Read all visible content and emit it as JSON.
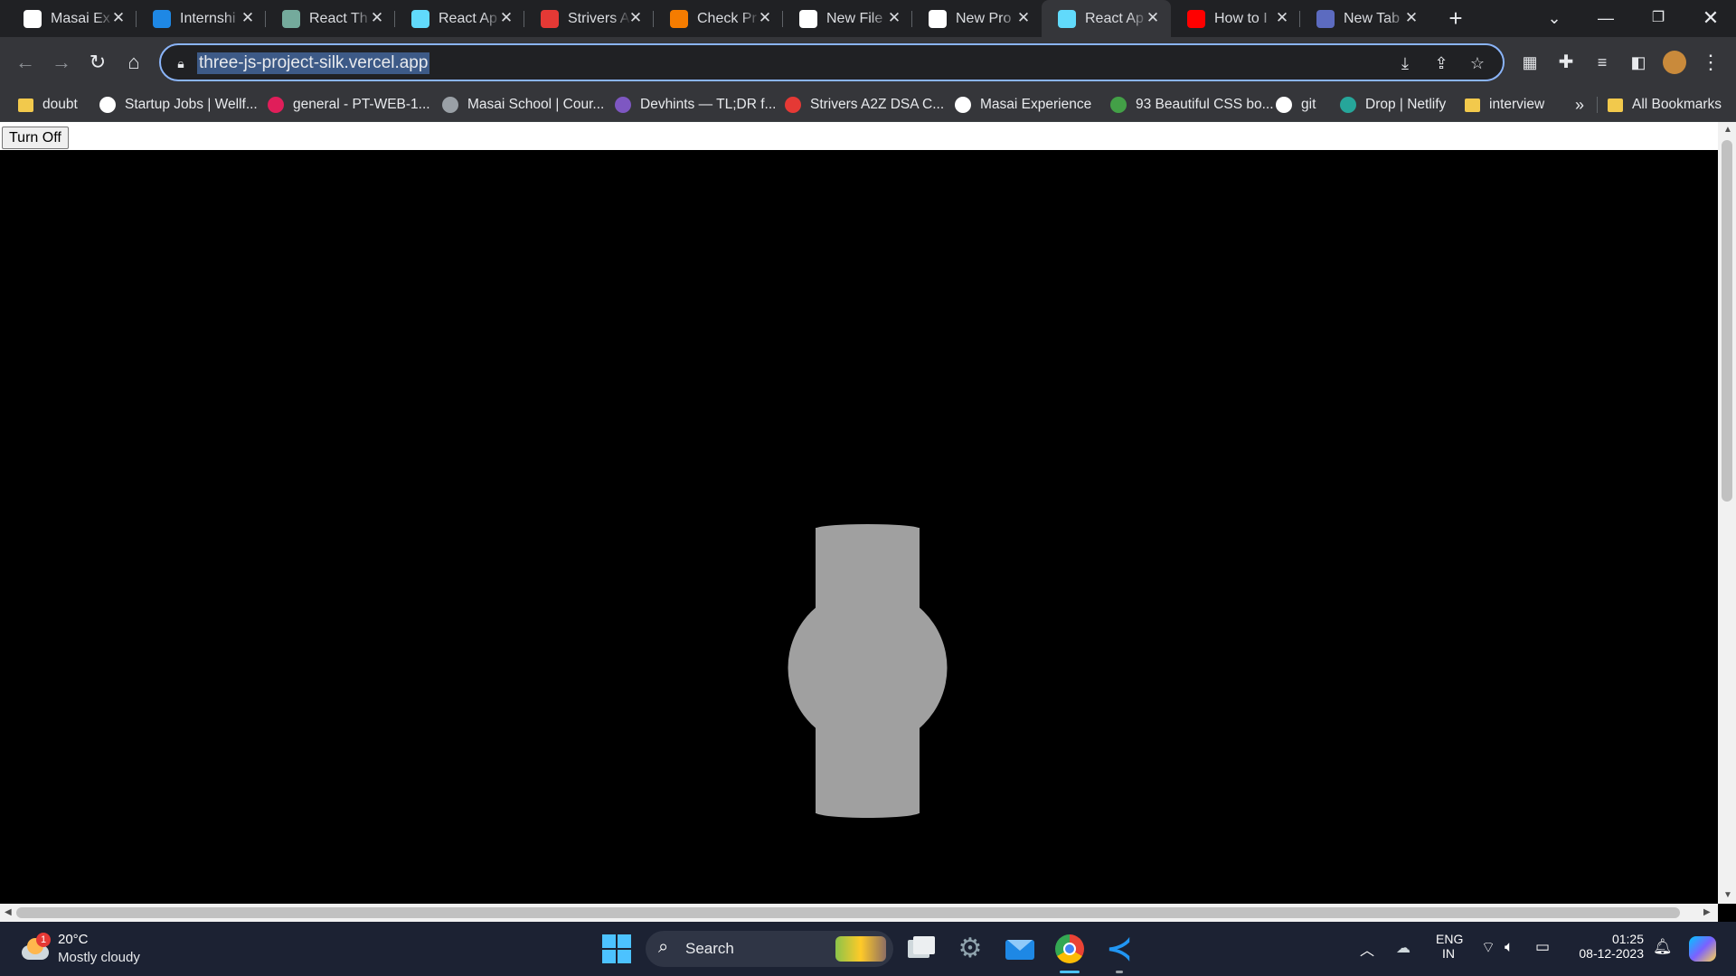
{
  "browser": {
    "tabs": [
      {
        "title": "Masai Ex",
        "icon": "masai-icon",
        "color": "#ffffff"
      },
      {
        "title": "Internshi",
        "icon": "internshala-icon",
        "color": "#1e88e5"
      },
      {
        "title": "React Th",
        "icon": "chatgpt-icon",
        "color": "#74aa9c"
      },
      {
        "title": "React Ap",
        "icon": "react-icon",
        "color": "#61dafb"
      },
      {
        "title": "Strivers A",
        "icon": "tuf-icon",
        "color": "#e53935"
      },
      {
        "title": "Check Pr",
        "icon": "codechef-icon",
        "color": "#f57c00"
      },
      {
        "title": "New File",
        "icon": "github-icon",
        "color": "#ffffff"
      },
      {
        "title": "New Pro",
        "icon": "vercel-icon",
        "color": "#ffffff"
      },
      {
        "title": "React Ap",
        "icon": "react-icon",
        "color": "#61dafb",
        "active": true
      },
      {
        "title": "How to I",
        "icon": "youtube-icon",
        "color": "#ff0000"
      },
      {
        "title": "New Tab",
        "icon": "newtab-icon",
        "color": "#5c6bc0"
      }
    ],
    "new_tab_symbol": "+",
    "url": "three-js-project-silk.vercel.app",
    "bookmarks": [
      {
        "label": "doubt",
        "icon": "folder-icon"
      },
      {
        "label": "Startup Jobs | Wellf...",
        "icon": "wellfound-icon"
      },
      {
        "label": "general - PT-WEB-1...",
        "icon": "slack-icon"
      },
      {
        "label": "Masai School | Cour...",
        "icon": "globe-icon"
      },
      {
        "label": "Devhints — TL;DR f...",
        "icon": "devhints-icon"
      },
      {
        "label": "Strivers A2Z DSA C...",
        "icon": "tuf-icon"
      },
      {
        "label": "Masai Experience",
        "icon": "masai-icon"
      },
      {
        "label": "93 Beautiful CSS bo...",
        "icon": "css-icon"
      },
      {
        "label": "git",
        "icon": "github-icon"
      },
      {
        "label": "Drop | Netlify",
        "icon": "netlify-icon"
      },
      {
        "label": "interview",
        "icon": "folder-icon"
      }
    ],
    "overflow_symbol": "»",
    "all_bookmarks": "All Bookmarks"
  },
  "page": {
    "button_label": "Turn Off",
    "object_color": "#a0a0a0",
    "background": "#000000"
  },
  "taskbar": {
    "weather_badge": "1",
    "temperature": "20°C",
    "condition": "Mostly cloudy",
    "search_label": "Search",
    "lang_primary": "ENG",
    "lang_secondary": "IN",
    "time": "01:25",
    "date": "08-12-2023"
  }
}
